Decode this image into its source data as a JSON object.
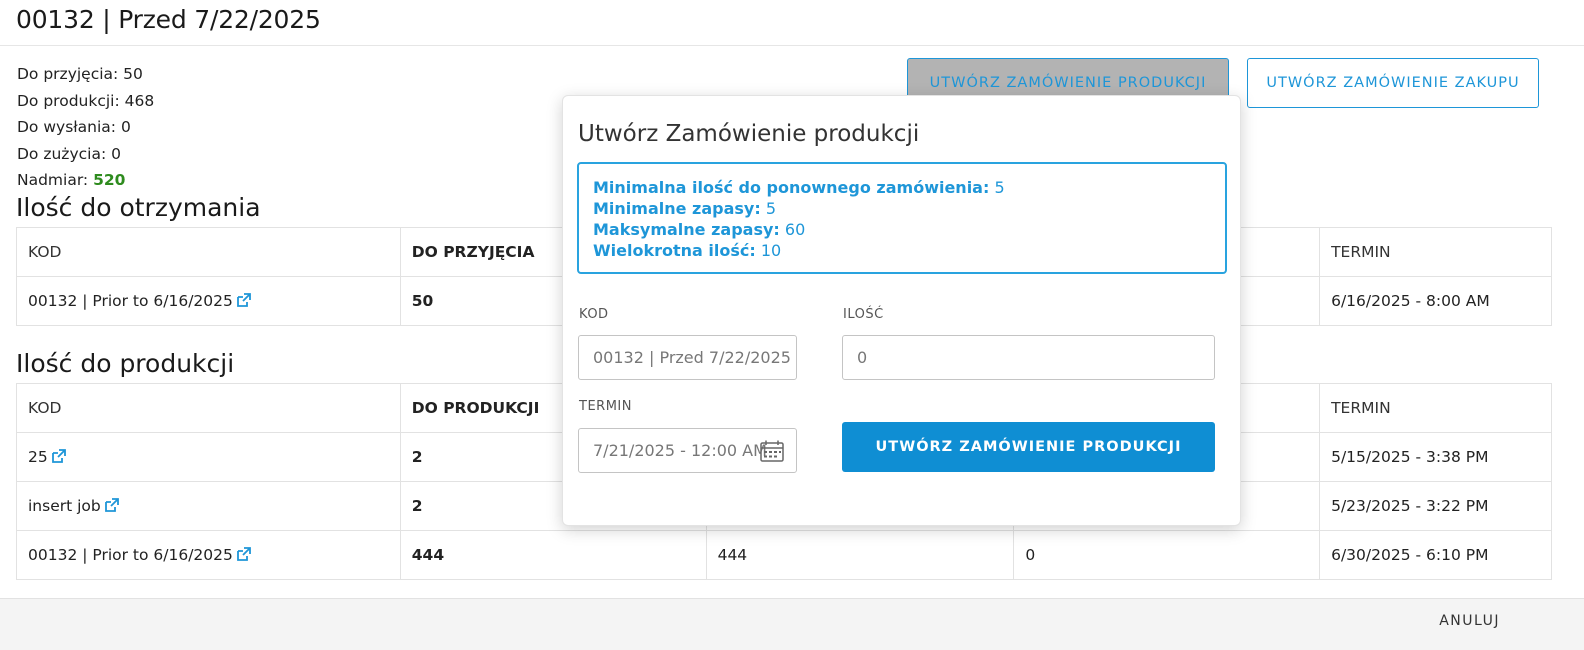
{
  "header": {
    "title": "00132 | Przed 7/22/2025"
  },
  "summary": {
    "to_receive": "Do przyjęcia: 50",
    "to_produce": "Do produkcji: 468",
    "to_ship": "Do wysłania: 0",
    "to_consume": "Do zużycia: 0",
    "excess_label": "Nadmiar: ",
    "excess_value": "520"
  },
  "actions": {
    "create_production_label": "UTWÓRZ ZAMÓWIENIE PRODUKCJI",
    "create_purchase_label": "UTWÓRZ ZAMÓWIENIE ZAKUPU"
  },
  "receive_section": {
    "title": "Ilość do otrzymania",
    "columns": [
      "KOD",
      "DO PRZYJĘCIA",
      "",
      "",
      "TERMIN"
    ],
    "rows": [
      {
        "code": "00132 | Prior to 6/16/2025",
        "qty": "50",
        "c3": "",
        "c4": "",
        "due": "6/16/2025 - 8:00 AM"
      }
    ]
  },
  "produce_section": {
    "title": "Ilość do produkcji",
    "columns": [
      "KOD",
      "DO PRODUKCJI",
      "",
      "",
      "TERMIN"
    ],
    "rows": [
      {
        "code": "25",
        "qty": "2",
        "c3": "",
        "c4": "",
        "due": "5/15/2025 - 3:38 PM"
      },
      {
        "code": "insert job",
        "qty": "2",
        "c3": "",
        "c4": "",
        "due": "5/23/2025 - 3:22 PM"
      },
      {
        "code": "00132 | Prior to 6/16/2025",
        "qty": "444",
        "c3": "444",
        "c4": "0",
        "due": "6/30/2025 - 6:10 PM"
      }
    ]
  },
  "popup": {
    "title": "Utwórz Zamówienie produkcji",
    "info": {
      "min_reorder_label": "Minimalna ilość do ponownego zamówienia:",
      "min_reorder_value": "5",
      "min_stock_label": "Minimalne zapasy:",
      "min_stock_value": "5",
      "max_stock_label": "Maksymalne zapasy:",
      "max_stock_value": "60",
      "multiple_label": "Wielokrotna ilość:",
      "multiple_value": "10"
    },
    "code_label": "KOD",
    "code_value": "00132 | Przed 7/22/2025",
    "qty_label": "ILOŚĆ",
    "qty_value": "0",
    "due_label": "TERMIN",
    "due_value": "7/21/2025 - 12:00 AM",
    "submit_label": "UTWÓRZ ZAMÓWIENIE PRODUKCJI"
  },
  "footer": {
    "cancel_label": "ANULUJ"
  },
  "colors": {
    "accent": "#1e96d8",
    "primary_button": "#0f8ed3",
    "excess": "#2e8b1e"
  }
}
